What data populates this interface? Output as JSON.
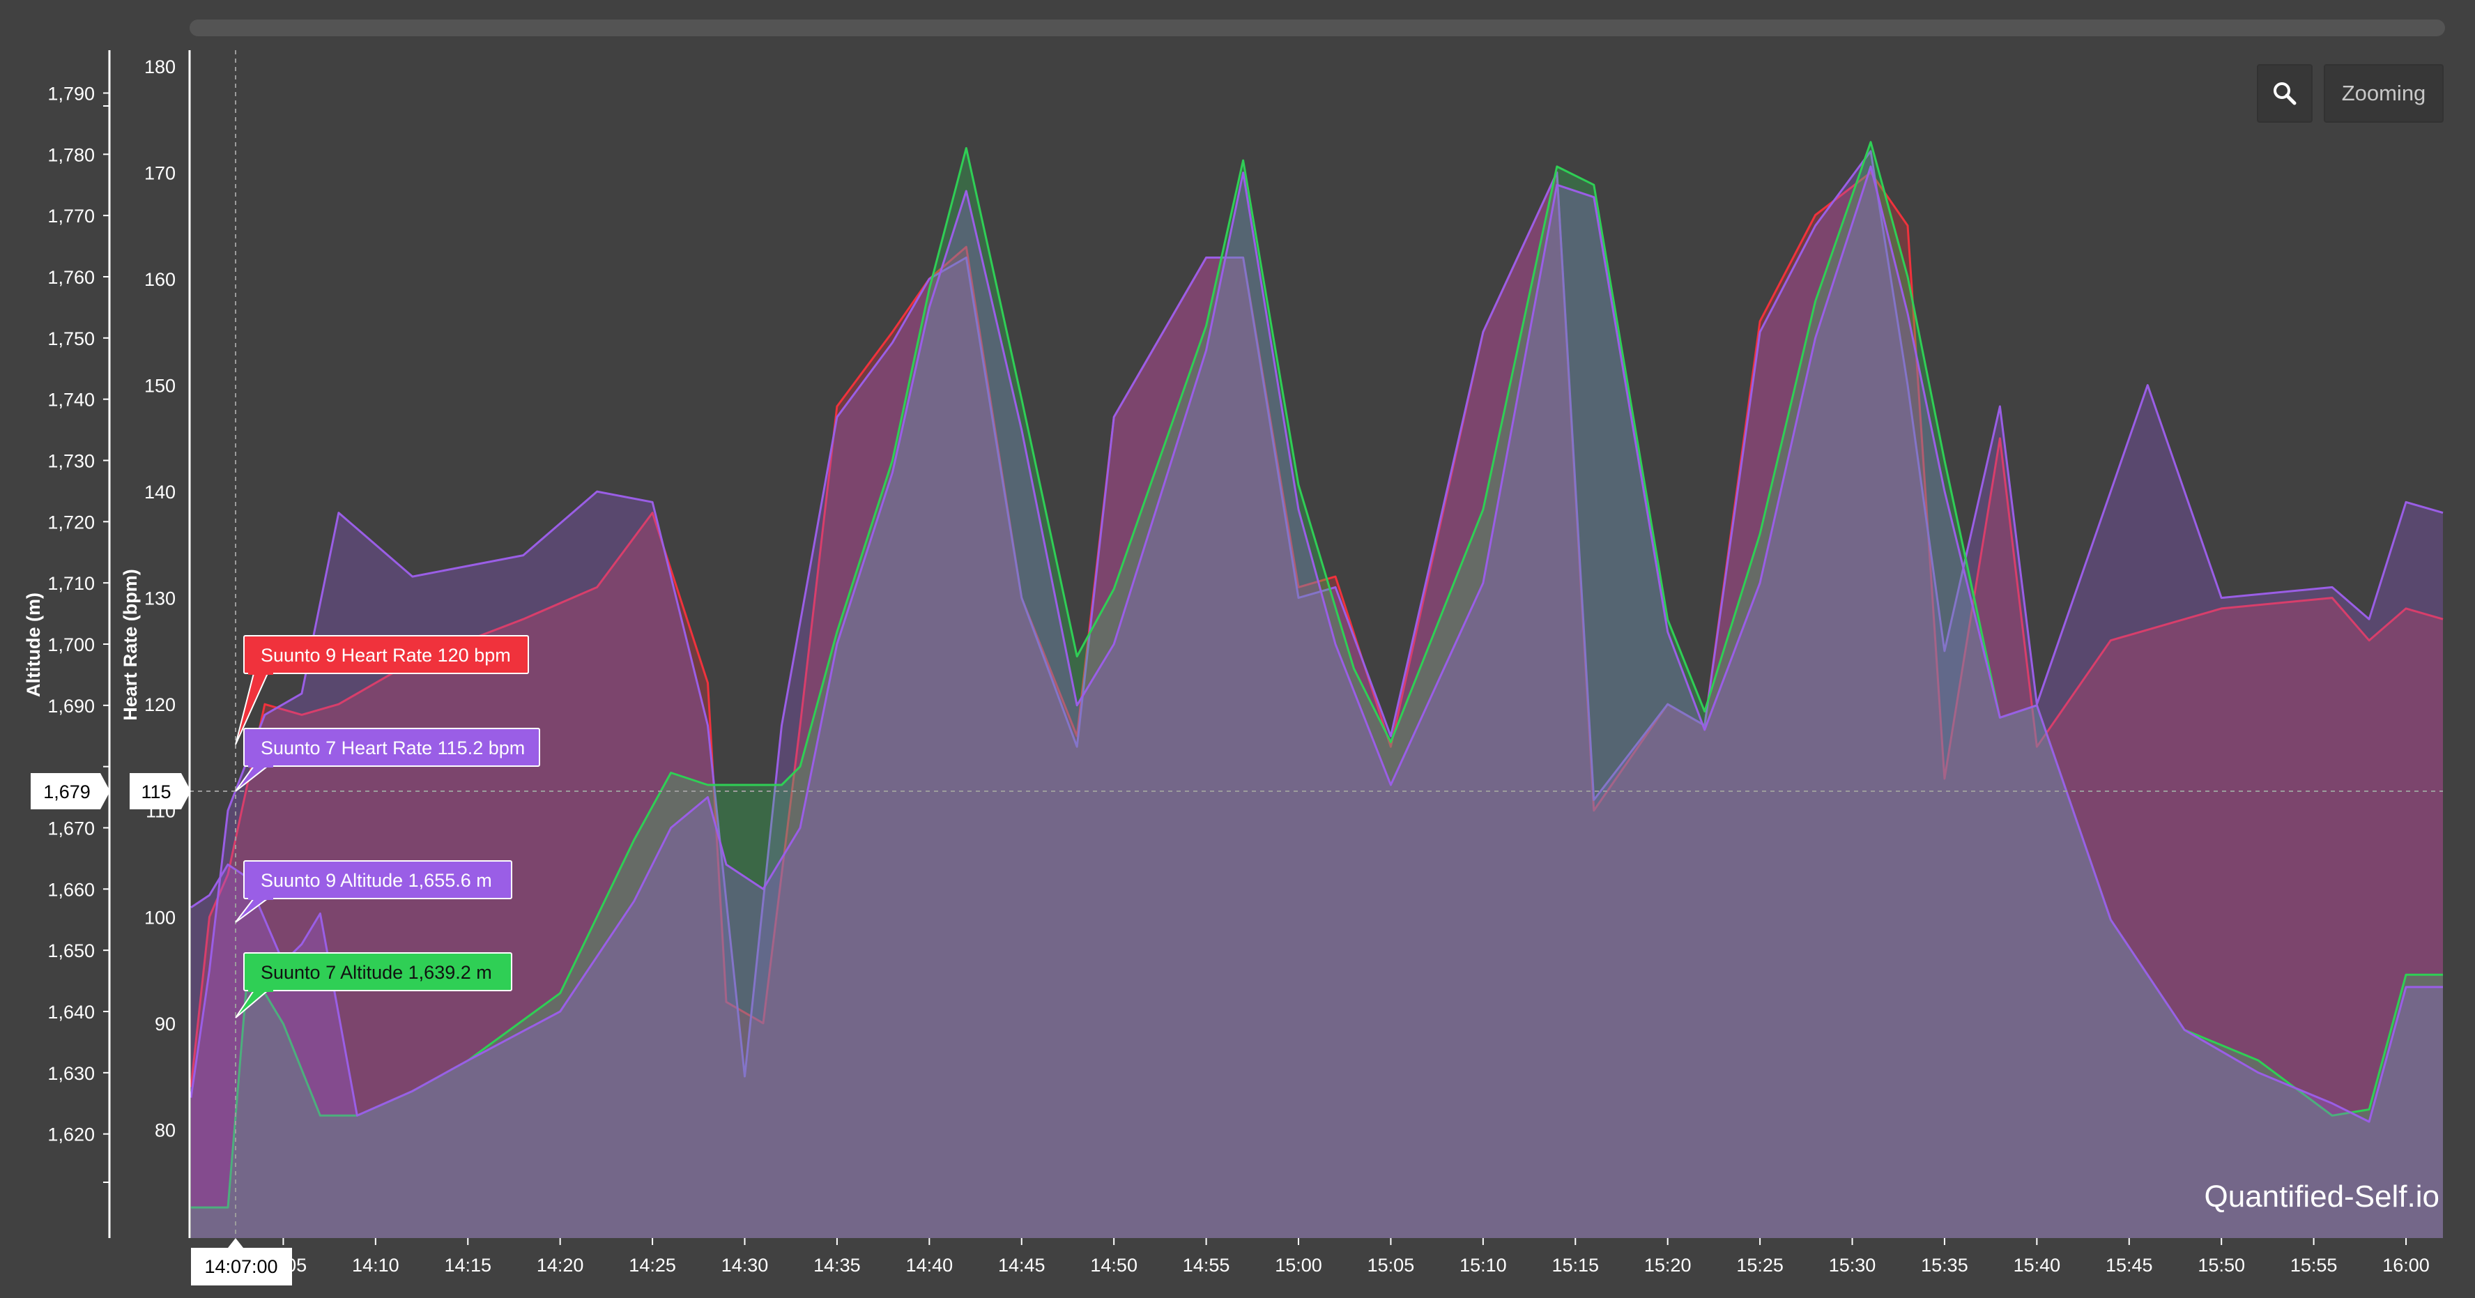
{
  "colors": {
    "background": "#414141",
    "suunto9_hr": "#f0323c",
    "suunto7_hr": "#9a5ee6",
    "suunto9_alt": "#9a5ee6",
    "suunto7_alt": "#2fcf55"
  },
  "toolbar": {
    "zoom_icon": "magnifier-icon",
    "zoom_label": "Zooming"
  },
  "watermark": "Quantified-Self.io",
  "cursor": {
    "time": "14:07:00",
    "altitude": "1,679",
    "heart_rate": "115"
  },
  "tooltips": [
    {
      "text": "Suunto 9 Heart Rate 120 bpm",
      "color": "#f0323c"
    },
    {
      "text": "Suunto 7 Heart Rate 115.2 bpm",
      "color": "#9a5ee6"
    },
    {
      "text": "Suunto 9 Altitude 1,655.6 m",
      "color": "#9a5ee6"
    },
    {
      "text": "Suunto 7 Altitude 1,639.2 m",
      "color": "#2fcf55"
    }
  ],
  "chart_data": {
    "type": "area",
    "grid": false,
    "yaxes": [
      {
        "title": "Altitude (m)",
        "ticks": [
          1620,
          1630,
          1640,
          1650,
          1660,
          1670,
          1680,
          1690,
          1700,
          1710,
          1720,
          1730,
          1740,
          1750,
          1760,
          1770,
          1780,
          1790
        ],
        "tick_labels": [
          "1,620",
          "1,630",
          "1,640",
          "1,650",
          "1,660",
          "1,670",
          "1,680",
          "1,690",
          "1,700",
          "1,710",
          "1,720",
          "1,730",
          "1,740",
          "1,750",
          "1,760",
          "1,770",
          "1,780",
          "1,790"
        ],
        "hidden_ticks": [
          1680
        ],
        "range": [
          1603,
          1797
        ]
      },
      {
        "title": "Heart Rate (bpm)",
        "ticks": [
          80,
          90,
          100,
          110,
          120,
          130,
          140,
          150,
          160,
          170,
          180
        ],
        "tick_labels": [
          "80",
          "90",
          "100",
          "110",
          "120",
          "130",
          "140",
          "150",
          "160",
          "170",
          "180]"
        ],
        "range": [
          69.8,
          181.5
        ]
      }
    ],
    "xaxis": {
      "range": [
        "14:00",
        "16:02"
      ],
      "tick_labels": [
        "14:05",
        "14:10",
        "14:15",
        "14:20",
        "14:25",
        "14:30",
        "14:35",
        "14:40",
        "14:45",
        "14:50",
        "14:55",
        "15:00",
        "15:05",
        "15:10",
        "15:15",
        "15:20",
        "15:25",
        "15:30",
        "15:35",
        "15:40",
        "15:45",
        "15:50",
        "15:55",
        "16:00"
      ],
      "ticks_min": [
        5,
        10,
        15,
        20,
        25,
        30,
        35,
        40,
        45,
        50,
        55,
        60,
        65,
        70,
        75,
        80,
        85,
        90,
        95,
        100,
        105,
        110,
        115,
        120
      ]
    },
    "series": [
      {
        "name": "Suunto 7 Altitude",
        "axis": "altitude",
        "color": "#2fcf55",
        "x": [
          "14:00",
          "14:02",
          "14:03",
          "14:04",
          "14:05",
          "14:07",
          "14:09",
          "14:12",
          "14:15",
          "14:20",
          "14:24",
          "14:26",
          "14:28",
          "14:32",
          "14:33",
          "14:35",
          "14:38",
          "14:40",
          "14:42",
          "14:45",
          "14:48",
          "14:50",
          "14:55",
          "14:57",
          "15:00",
          "15:03",
          "15:05",
          "15:10",
          "15:14",
          "15:16",
          "15:20",
          "15:22",
          "15:25",
          "15:28",
          "15:31",
          "15:33",
          "15:35",
          "15:38",
          "15:40",
          "15:44",
          "15:48",
          "15:52",
          "15:56",
          "15:58",
          "16:00",
          "16:02"
        ],
        "y": [
          1608,
          1608,
          1644,
          1643,
          1638,
          1623,
          1623,
          1627,
          1632,
          1643,
          1668,
          1679,
          1677,
          1677,
          1680,
          1702,
          1730,
          1758,
          1781,
          1740,
          1698,
          1709,
          1752,
          1779,
          1726,
          1696,
          1684,
          1722,
          1778,
          1775,
          1704,
          1689,
          1718,
          1756,
          1782,
          1760,
          1730,
          1688,
          1690,
          1655,
          1637,
          1632,
          1623,
          1624,
          1646,
          1646
        ]
      },
      {
        "name": "Suunto 9 Altitude",
        "axis": "altitude",
        "color": "#9a5ee6",
        "x": [
          "14:00",
          "14:01",
          "14:02",
          "14:03",
          "14:05",
          "14:06",
          "14:07",
          "14:09",
          "14:12",
          "14:15",
          "14:20",
          "14:24",
          "14:26",
          "14:28",
          "14:29",
          "14:31",
          "14:33",
          "14:35",
          "14:38",
          "14:40",
          "14:42",
          "14:45",
          "14:48",
          "14:50",
          "14:55",
          "14:57",
          "15:00",
          "15:02",
          "15:05",
          "15:10",
          "15:14",
          "15:16",
          "15:20",
          "15:22",
          "15:25",
          "15:28",
          "15:31",
          "15:33",
          "15:35",
          "15:38",
          "15:40",
          "15:44",
          "15:48",
          "15:52",
          "15:56",
          "15:58",
          "16:00",
          "16:02"
        ],
        "y": [
          1657,
          1659,
          1664,
          1662,
          1648,
          1651,
          1656,
          1623,
          1627,
          1632,
          1640,
          1658,
          1670,
          1675,
          1664,
          1660,
          1670,
          1700,
          1728,
          1755,
          1774,
          1735,
          1690,
          1700,
          1748,
          1777,
          1722,
          1700,
          1677,
          1710,
          1775,
          1773,
          1702,
          1686,
          1710,
          1750,
          1778,
          1754,
          1725,
          1688,
          1690,
          1655,
          1637,
          1630,
          1625,
          1622,
          1644,
          1644
        ]
      },
      {
        "name": "Suunto 9 Heart Rate",
        "axis": "heart_rate",
        "color": "#f0323c",
        "x": [
          "14:00",
          "14:01",
          "14:02",
          "14:04",
          "14:06",
          "14:08",
          "14:12",
          "14:18",
          "14:22",
          "14:25",
          "14:28",
          "14:29",
          "14:31",
          "14:33",
          "14:35",
          "14:38",
          "14:40",
          "14:42",
          "14:45",
          "14:48",
          "14:50",
          "14:55",
          "14:57",
          "15:00",
          "15:02",
          "15:05",
          "15:10",
          "15:14",
          "15:16",
          "15:20",
          "15:22",
          "15:25",
          "15:28",
          "15:31",
          "15:33",
          "15:35",
          "15:38",
          "15:40",
          "15:44",
          "15:50",
          "15:56",
          "15:58",
          "16:00",
          "16:02"
        ],
        "y": [
          84,
          100,
          104,
          120,
          119,
          120,
          124,
          128,
          131,
          138,
          122,
          92,
          90,
          118,
          148,
          155,
          160,
          163,
          130,
          117,
          147,
          162,
          162,
          131,
          132,
          116,
          155,
          170,
          110,
          120,
          118,
          156,
          166,
          170,
          165,
          113,
          145,
          116,
          126,
          129,
          130,
          126,
          129,
          128
        ]
      },
      {
        "name": "Suunto 7 Heart Rate",
        "axis": "heart_rate",
        "color": "#9a5ee6",
        "x": [
          "14:00",
          "14:01",
          "14:02",
          "14:04",
          "14:06",
          "14:08",
          "14:12",
          "14:18",
          "14:22",
          "14:25",
          "14:28",
          "14:30",
          "14:32",
          "14:35",
          "14:38",
          "14:40",
          "14:42",
          "14:45",
          "14:48",
          "14:50",
          "14:55",
          "14:57",
          "15:00",
          "15:02",
          "15:05",
          "15:10",
          "15:14",
          "15:16",
          "15:20",
          "15:22",
          "15:25",
          "15:28",
          "15:31",
          "15:33",
          "15:35",
          "15:38",
          "15:40",
          "15:42",
          "15:44",
          "15:46",
          "15:50",
          "15:56",
          "15:58",
          "16:00",
          "16:02"
        ],
        "y": [
          83,
          95,
          110,
          119,
          121,
          138,
          132,
          134,
          140,
          139,
          118,
          85,
          118,
          147,
          154,
          160,
          162,
          130,
          116,
          147,
          162,
          162,
          130,
          131,
          117,
          155,
          170,
          111,
          120,
          118,
          155,
          165,
          172,
          150,
          125,
          148,
          120,
          130,
          140,
          150,
          130,
          131,
          128,
          139,
          138
        ]
      }
    ]
  }
}
